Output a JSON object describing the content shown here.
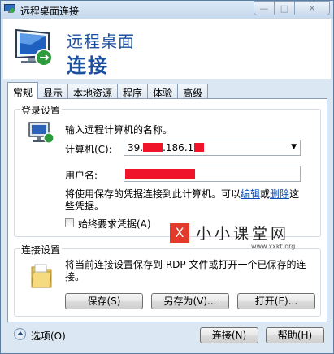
{
  "window": {
    "title": "远程桌面连接",
    "min_label": "—",
    "max_label": "□",
    "close_label": "✕"
  },
  "banner": {
    "line1": "远程桌面",
    "line2": "连接"
  },
  "tabs": [
    {
      "label": "常规",
      "active": true
    },
    {
      "label": "显示"
    },
    {
      "label": "本地资源"
    },
    {
      "label": "程序"
    },
    {
      "label": "体验"
    },
    {
      "label": "高级"
    }
  ],
  "login": {
    "group_title": "登录设置",
    "prompt": "输入远程计算机的名称。",
    "computer_label": "计算机(C):",
    "computer_value_part1": "39.",
    "computer_value_part2": ".186.1",
    "username_label": "用户名:",
    "info_text_1": "将使用保存的凭据连接到此计算机。可以",
    "edit_link": "编辑",
    "info_or": "或",
    "delete_link": "删除",
    "info_text_2": "这",
    "info_text_3": "些凭据。",
    "always_ask_label": "始终要求凭据(A)"
  },
  "connection": {
    "group_title": "连接设置",
    "description_1": "将当前连接设置保存到 RDP 文件或打开一个已保存的连",
    "description_2": "接。",
    "save_label": "保存(S)",
    "save_as_label": "另存为(V)...",
    "open_label": "打开(E)..."
  },
  "watermark": {
    "box": "X",
    "text": "小小课堂网",
    "url": "www.xxkt.org"
  },
  "footer": {
    "options_label": "选项(O)",
    "connect_label": "连接(N)",
    "help_label": "帮助(H)"
  },
  "colors": {
    "accent": "#1b4fa0",
    "link": "#0a4fb7",
    "redaction": "#f0142a"
  }
}
